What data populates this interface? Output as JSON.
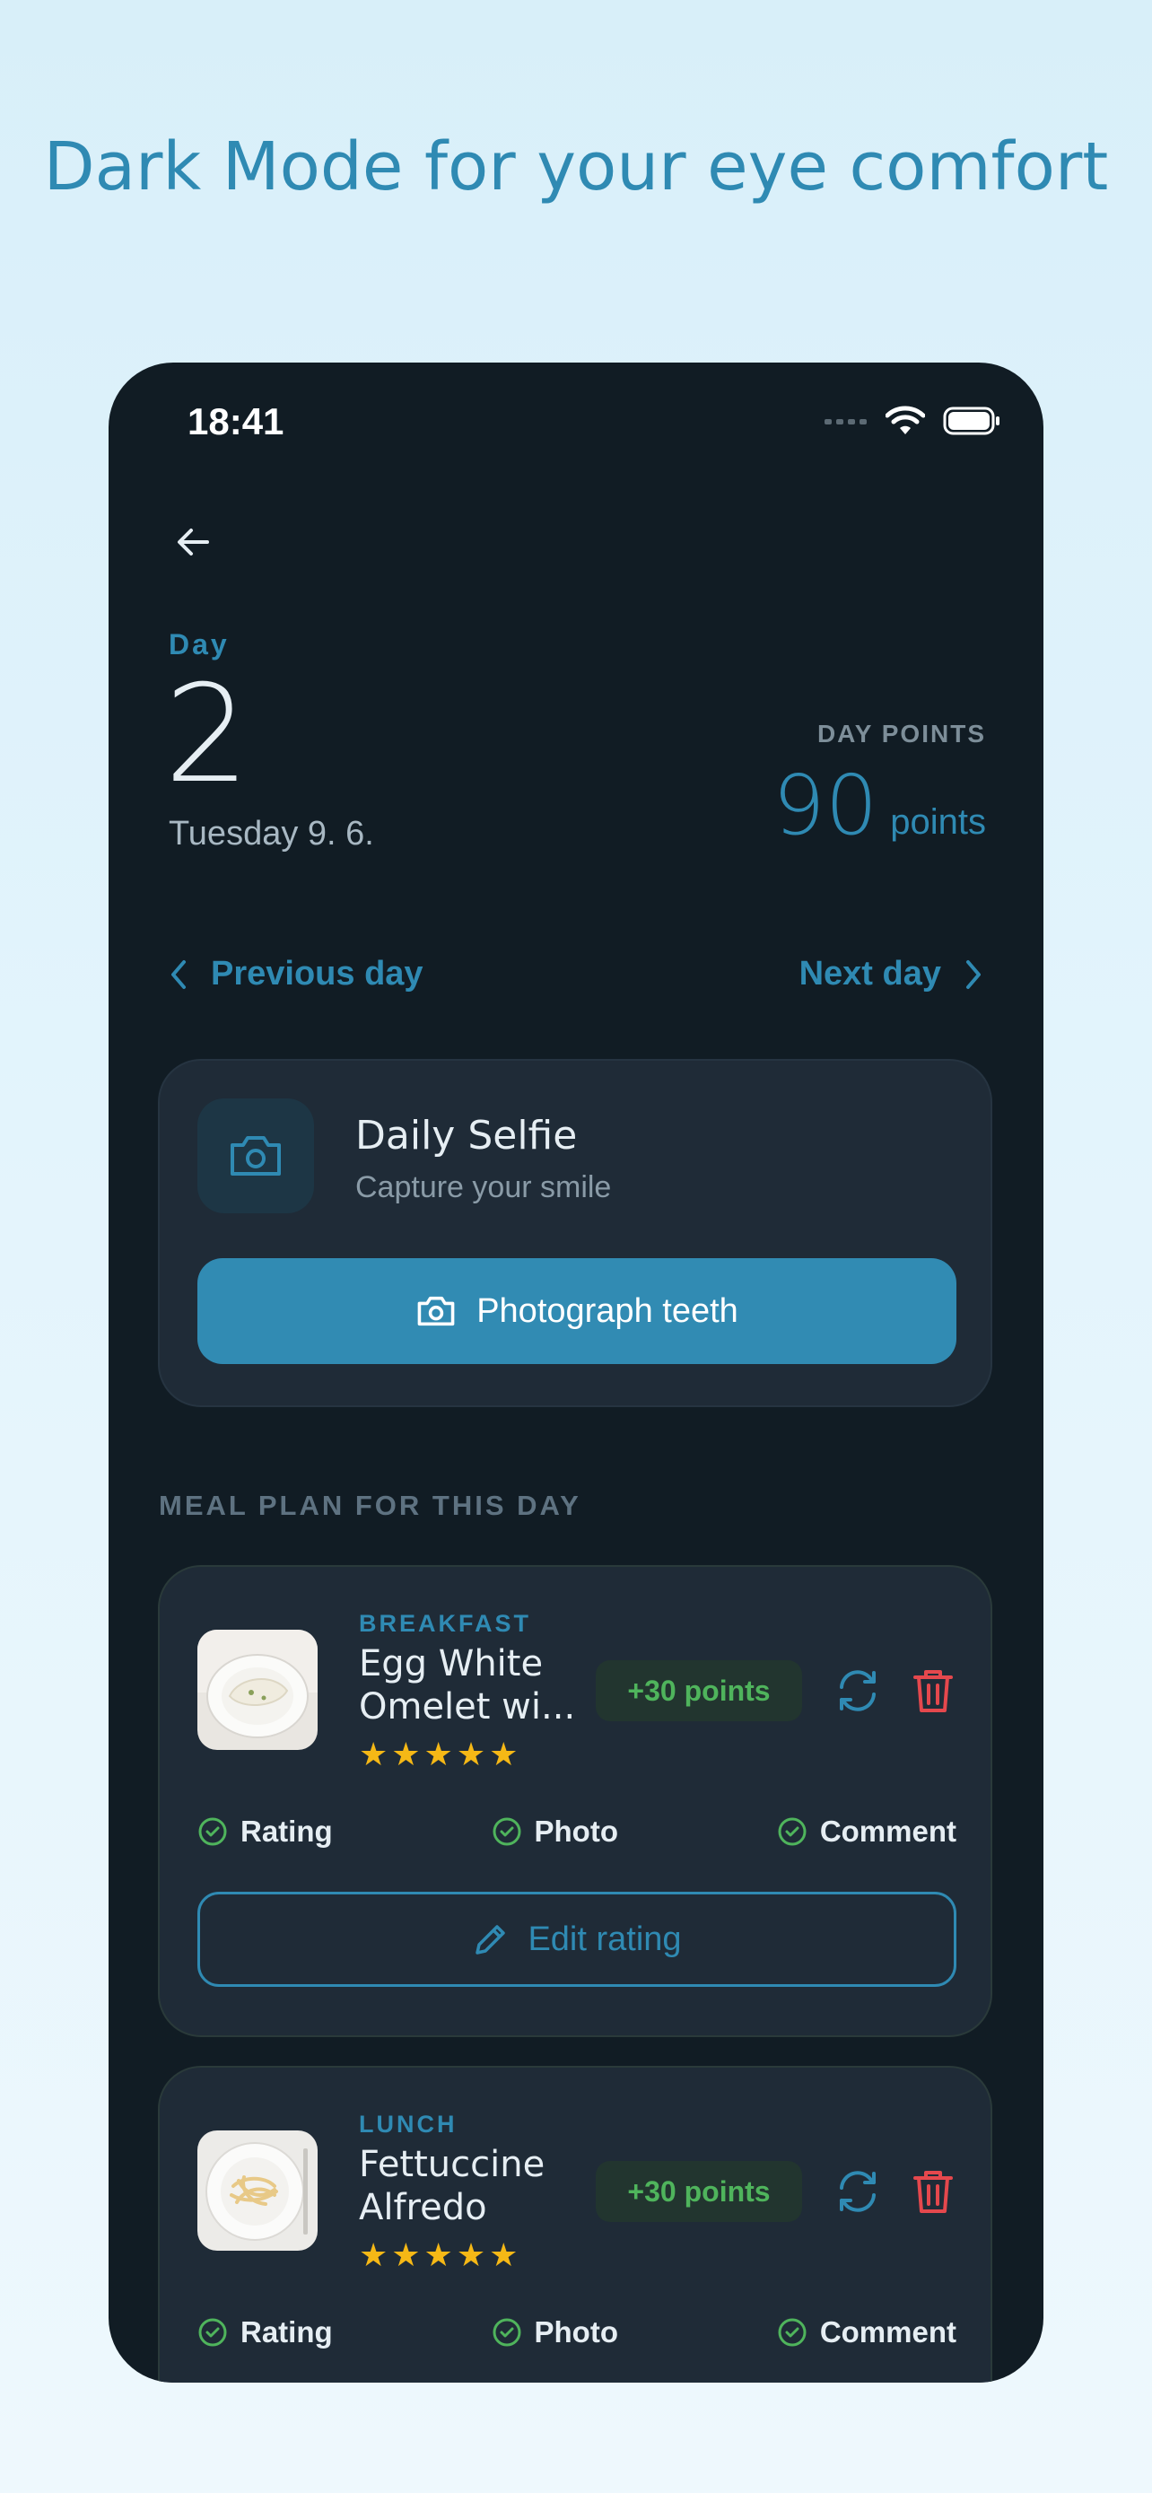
{
  "headline": "Dark Mode for your eye comfort",
  "status": {
    "time": "18:41"
  },
  "day": {
    "label": "Day",
    "number": "2",
    "date": "Tuesday 9. 6."
  },
  "points": {
    "label": "DAY POINTS",
    "value": "90",
    "unit": "points"
  },
  "nav": {
    "prev": "Previous day",
    "next": "Next day"
  },
  "selfie": {
    "title": "Daily Selfie",
    "subtitle": "Capture your smile",
    "button": "Photograph teeth"
  },
  "section_title": "MEAL PLAN FOR THIS DAY",
  "meals": [
    {
      "type": "BREAKFAST",
      "name": "Egg White Omelet wi...",
      "stars": "★★★★★",
      "rating": 5,
      "points": "+30 points",
      "checks": [
        "Rating",
        "Photo",
        "Comment"
      ],
      "edit": "Edit rating"
    },
    {
      "type": "LUNCH",
      "name": "Fettuccine Alfredo",
      "stars": "★★★★★",
      "rating": 5,
      "points": "+30 points",
      "checks": [
        "Rating",
        "Photo",
        "Comment"
      ]
    }
  ],
  "colors": {
    "accent": "#2f8ab3",
    "success": "#4fb45c",
    "danger": "#e5484d",
    "star": "#f5b816",
    "bg": "#111c24",
    "card": "#1f2b37"
  }
}
